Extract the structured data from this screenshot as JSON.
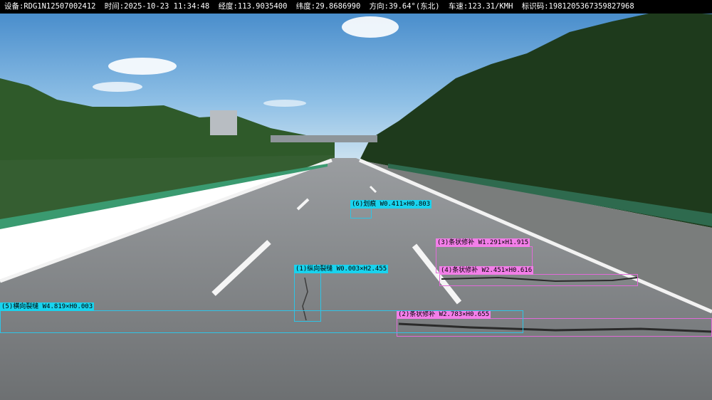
{
  "overlay": {
    "device": "设备:RDG1N12507002412",
    "time": "时间:2025-10-23 11:34:48",
    "longitude": "经度:113.9035400",
    "latitude": "纬度:29.8686990",
    "direction": "方向:39.64°(东北)",
    "speed": "车速:123.31/KMH",
    "id_code": "标识码:1981205367359827968"
  },
  "detections": [
    {
      "label": "(1)纵向裂缝 W0.003×H2.455",
      "color": "#19d3ee"
    },
    {
      "label": "(2)条状修补 W2.783×H0.655",
      "color": "#f37ee9"
    },
    {
      "label": "(3)条状修补 W1.291×H1.915",
      "color": "#f37ee9"
    },
    {
      "label": "(4)条状修补 W2.451×H0.616",
      "color": "#f37ee9"
    },
    {
      "label": "(5)横向裂缝 W4.819×H0.003",
      "color": "#19d3ee"
    },
    {
      "label": "(6)划痕 W0.411×H0.803",
      "color": "#19d3ee"
    }
  ]
}
